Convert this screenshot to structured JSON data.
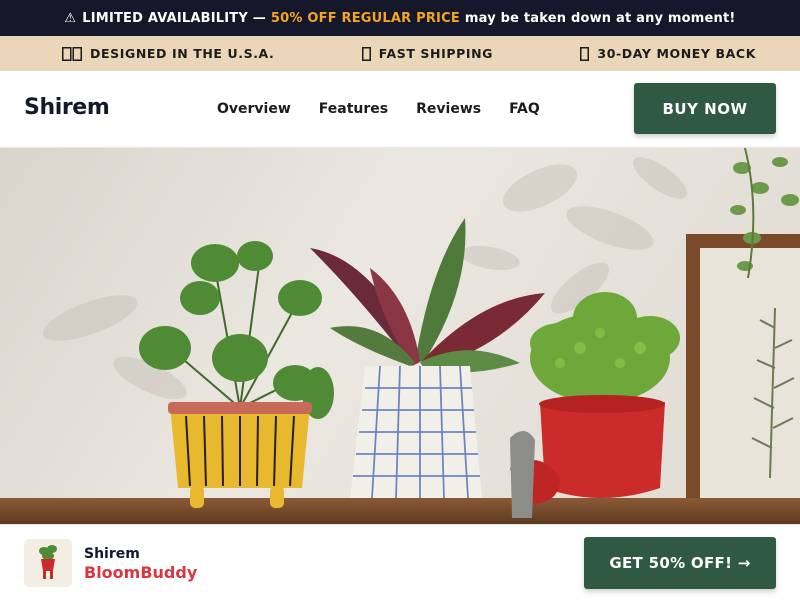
{
  "announcement": {
    "icon": "warning-icon",
    "lead": "LIMITED AVAILABILITY —",
    "highlight": "50% OFF REGULAR PRICE",
    "tail": "may be taken down at any moment!",
    "highlight_color": "#f5a524",
    "background": "#14182a"
  },
  "trust_bar": {
    "background": "#ead6b8",
    "items": [
      {
        "icon": "flag-icon",
        "label": "DESIGNED IN THE U.S.A."
      },
      {
        "icon": "truck-icon",
        "label": "FAST SHIPPING"
      },
      {
        "icon": "shield-icon",
        "label": "30-DAY MONEY BACK"
      }
    ]
  },
  "header": {
    "logo": "Shirem",
    "nav": [
      "Overview",
      "Features",
      "Reviews",
      "FAQ"
    ],
    "buy_button": "BUY NOW",
    "button_color": "#2f5943"
  },
  "hero": {
    "image": "hero-planters-photo"
  },
  "sticky_bar": {
    "brand": "Shirem",
    "product": "BloomBuddy",
    "product_color": "#d9363e",
    "cta": "GET 50% OFF! →",
    "thumbnail": "product-thumbnail"
  }
}
